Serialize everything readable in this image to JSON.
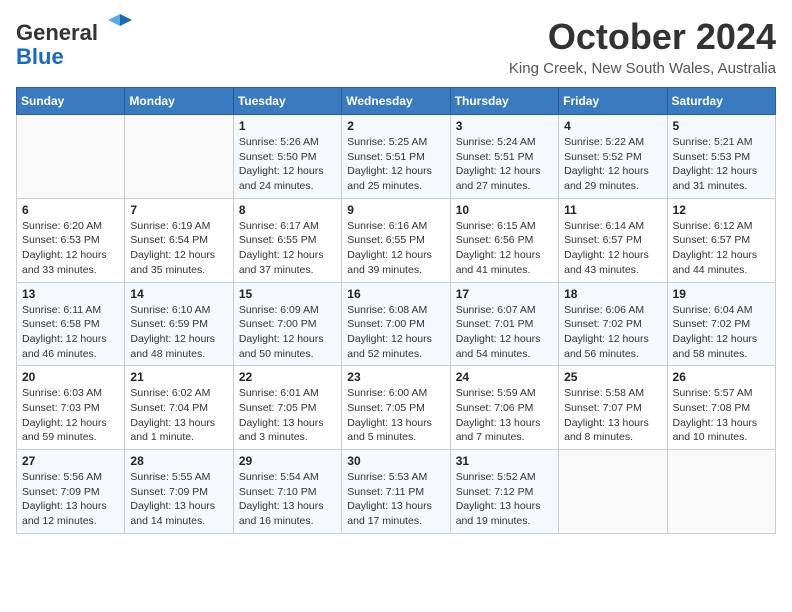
{
  "header": {
    "logo_line1": "General",
    "logo_line2": "Blue",
    "month": "October 2024",
    "location": "King Creek, New South Wales, Australia"
  },
  "weekdays": [
    "Sunday",
    "Monday",
    "Tuesday",
    "Wednesday",
    "Thursday",
    "Friday",
    "Saturday"
  ],
  "weeks": [
    [
      {
        "day": "",
        "info": ""
      },
      {
        "day": "",
        "info": ""
      },
      {
        "day": "1",
        "info": "Sunrise: 5:26 AM\nSunset: 5:50 PM\nDaylight: 12 hours and 24 minutes."
      },
      {
        "day": "2",
        "info": "Sunrise: 5:25 AM\nSunset: 5:51 PM\nDaylight: 12 hours and 25 minutes."
      },
      {
        "day": "3",
        "info": "Sunrise: 5:24 AM\nSunset: 5:51 PM\nDaylight: 12 hours and 27 minutes."
      },
      {
        "day": "4",
        "info": "Sunrise: 5:22 AM\nSunset: 5:52 PM\nDaylight: 12 hours and 29 minutes."
      },
      {
        "day": "5",
        "info": "Sunrise: 5:21 AM\nSunset: 5:53 PM\nDaylight: 12 hours and 31 minutes."
      }
    ],
    [
      {
        "day": "6",
        "info": "Sunrise: 6:20 AM\nSunset: 6:53 PM\nDaylight: 12 hours and 33 minutes."
      },
      {
        "day": "7",
        "info": "Sunrise: 6:19 AM\nSunset: 6:54 PM\nDaylight: 12 hours and 35 minutes."
      },
      {
        "day": "8",
        "info": "Sunrise: 6:17 AM\nSunset: 6:55 PM\nDaylight: 12 hours and 37 minutes."
      },
      {
        "day": "9",
        "info": "Sunrise: 6:16 AM\nSunset: 6:55 PM\nDaylight: 12 hours and 39 minutes."
      },
      {
        "day": "10",
        "info": "Sunrise: 6:15 AM\nSunset: 6:56 PM\nDaylight: 12 hours and 41 minutes."
      },
      {
        "day": "11",
        "info": "Sunrise: 6:14 AM\nSunset: 6:57 PM\nDaylight: 12 hours and 43 minutes."
      },
      {
        "day": "12",
        "info": "Sunrise: 6:12 AM\nSunset: 6:57 PM\nDaylight: 12 hours and 44 minutes."
      }
    ],
    [
      {
        "day": "13",
        "info": "Sunrise: 6:11 AM\nSunset: 6:58 PM\nDaylight: 12 hours and 46 minutes."
      },
      {
        "day": "14",
        "info": "Sunrise: 6:10 AM\nSunset: 6:59 PM\nDaylight: 12 hours and 48 minutes."
      },
      {
        "day": "15",
        "info": "Sunrise: 6:09 AM\nSunset: 7:00 PM\nDaylight: 12 hours and 50 minutes."
      },
      {
        "day": "16",
        "info": "Sunrise: 6:08 AM\nSunset: 7:00 PM\nDaylight: 12 hours and 52 minutes."
      },
      {
        "day": "17",
        "info": "Sunrise: 6:07 AM\nSunset: 7:01 PM\nDaylight: 12 hours and 54 minutes."
      },
      {
        "day": "18",
        "info": "Sunrise: 6:06 AM\nSunset: 7:02 PM\nDaylight: 12 hours and 56 minutes."
      },
      {
        "day": "19",
        "info": "Sunrise: 6:04 AM\nSunset: 7:02 PM\nDaylight: 12 hours and 58 minutes."
      }
    ],
    [
      {
        "day": "20",
        "info": "Sunrise: 6:03 AM\nSunset: 7:03 PM\nDaylight: 12 hours and 59 minutes."
      },
      {
        "day": "21",
        "info": "Sunrise: 6:02 AM\nSunset: 7:04 PM\nDaylight: 13 hours and 1 minute."
      },
      {
        "day": "22",
        "info": "Sunrise: 6:01 AM\nSunset: 7:05 PM\nDaylight: 13 hours and 3 minutes."
      },
      {
        "day": "23",
        "info": "Sunrise: 6:00 AM\nSunset: 7:05 PM\nDaylight: 13 hours and 5 minutes."
      },
      {
        "day": "24",
        "info": "Sunrise: 5:59 AM\nSunset: 7:06 PM\nDaylight: 13 hours and 7 minutes."
      },
      {
        "day": "25",
        "info": "Sunrise: 5:58 AM\nSunset: 7:07 PM\nDaylight: 13 hours and 8 minutes."
      },
      {
        "day": "26",
        "info": "Sunrise: 5:57 AM\nSunset: 7:08 PM\nDaylight: 13 hours and 10 minutes."
      }
    ],
    [
      {
        "day": "27",
        "info": "Sunrise: 5:56 AM\nSunset: 7:09 PM\nDaylight: 13 hours and 12 minutes."
      },
      {
        "day": "28",
        "info": "Sunrise: 5:55 AM\nSunset: 7:09 PM\nDaylight: 13 hours and 14 minutes."
      },
      {
        "day": "29",
        "info": "Sunrise: 5:54 AM\nSunset: 7:10 PM\nDaylight: 13 hours and 16 minutes."
      },
      {
        "day": "30",
        "info": "Sunrise: 5:53 AM\nSunset: 7:11 PM\nDaylight: 13 hours and 17 minutes."
      },
      {
        "day": "31",
        "info": "Sunrise: 5:52 AM\nSunset: 7:12 PM\nDaylight: 13 hours and 19 minutes."
      },
      {
        "day": "",
        "info": ""
      },
      {
        "day": "",
        "info": ""
      }
    ]
  ]
}
